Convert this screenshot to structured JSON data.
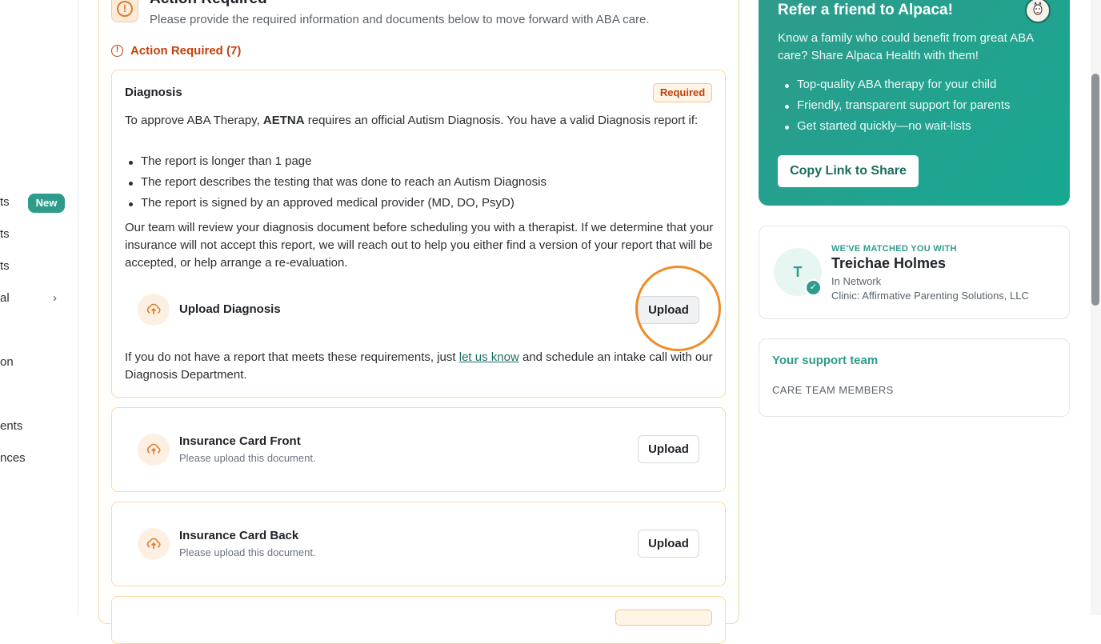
{
  "sidebar": {
    "items": [
      {
        "label": "ts",
        "badge": "New"
      },
      {
        "label": "ts"
      },
      {
        "label": "ts"
      },
      {
        "label": "al"
      },
      {
        "label": "on"
      },
      {
        "label": "ents"
      },
      {
        "label": "nces"
      }
    ]
  },
  "header": {
    "title": "Action Required",
    "subtitle": "Please provide the required information and documents below to move forward with ABA care."
  },
  "action_required": {
    "label": "Action Required (7)"
  },
  "diagnosis": {
    "title": "Diagnosis",
    "badge": "Required",
    "intro_a": "To approve ABA Therapy, ",
    "intro_bold": "AETNA",
    "intro_b": " requires an official Autism Diagnosis. You have a valid Diagnosis report if:",
    "bullets": [
      "The report is longer than 1 page",
      "The report describes the testing that was done to reach an Autism Diagnosis",
      "The report is signed by an approved medical provider (MD, DO, PsyD)"
    ],
    "review_text": "Our team will review your diagnosis document before scheduling you with a therapist. If we determine that your insurance will not accept this report, we will reach out to help you either find a version of your report that will be accepted, or help arrange a re-evaluation.",
    "upload_label": "Upload Diagnosis",
    "upload_button": "Upload",
    "footer_a": "If you do not have a report that meets these requirements, just ",
    "footer_link": "let us know",
    "footer_b": " and schedule an intake call with our Diagnosis Department."
  },
  "documents": [
    {
      "title": "Insurance Card Front",
      "subtitle": "Please upload this document.",
      "button": "Upload"
    },
    {
      "title": "Insurance Card Back",
      "subtitle": "Please upload this document.",
      "button": "Upload"
    }
  ],
  "referral": {
    "title": "Refer a friend to Alpaca!",
    "text": "Know a family who could benefit from great ABA care? Share Alpaca Health with them!",
    "bullets": [
      "Top-quality ABA therapy for your child",
      "Friendly, transparent support for parents",
      "Get started quickly—no wait-lists"
    ],
    "button": "Copy Link to Share"
  },
  "match": {
    "kicker": "WE'VE MATCHED YOU WITH",
    "avatar_initial": "T",
    "name": "Treichae Holmes",
    "network": "In Network",
    "clinic": "Clinic: Affirmative Parenting Solutions, LLC"
  },
  "support": {
    "title": "Your support team",
    "subtitle": "CARE TEAM MEMBERS"
  },
  "colors": {
    "accent_teal": "#2f9b8b",
    "warning_orange": "#c2410c",
    "highlight_ring": "#ef8c2a"
  }
}
